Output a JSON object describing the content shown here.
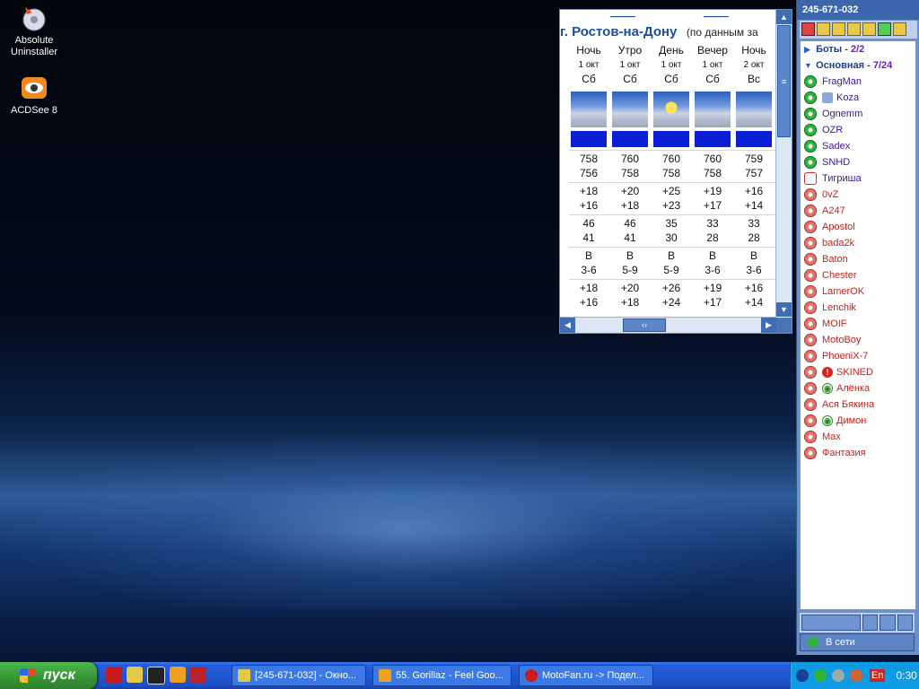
{
  "desktop": {
    "icons": [
      {
        "label_line1": "Absolute",
        "label_line2": "Uninstaller",
        "icon": "uninstaller-icon"
      },
      {
        "label_line1": "ACDSee 8",
        "label_line2": "",
        "icon": "acdsee-icon"
      }
    ]
  },
  "weather": {
    "city": "г. Ростов-на-Дону",
    "source": "(по данным за",
    "columns": [
      {
        "period": "Ночь",
        "date": "1 окт",
        "dow": "Сб",
        "icon": "cloudy",
        "pressure": [
          "758",
          "756"
        ],
        "temp": [
          "+18",
          "+16"
        ],
        "humidity": [
          "46",
          "41"
        ],
        "wind_dir": "В",
        "wind_speed": "3-6",
        "feels": [
          "+18",
          "+16"
        ]
      },
      {
        "period": "Утро",
        "date": "1 окт",
        "dow": "Сб",
        "icon": "cloudy",
        "pressure": [
          "760",
          "758"
        ],
        "temp": [
          "+20",
          "+18"
        ],
        "humidity": [
          "46",
          "41"
        ],
        "wind_dir": "В",
        "wind_speed": "5-9",
        "feels": [
          "+20",
          "+18"
        ]
      },
      {
        "period": "День",
        "date": "1 окт",
        "dow": "Сб",
        "icon": "partly-sunny",
        "pressure": [
          "760",
          "758"
        ],
        "temp": [
          "+25",
          "+23"
        ],
        "humidity": [
          "35",
          "30"
        ],
        "wind_dir": "В",
        "wind_speed": "5-9",
        "feels": [
          "+26",
          "+24"
        ]
      },
      {
        "period": "Вечер",
        "date": "1 окт",
        "dow": "Сб",
        "icon": "cloudy",
        "pressure": [
          "760",
          "758"
        ],
        "temp": [
          "+19",
          "+17"
        ],
        "humidity": [
          "33",
          "28"
        ],
        "wind_dir": "В",
        "wind_speed": "3-6",
        "feels": [
          "+19",
          "+17"
        ]
      },
      {
        "period": "Ночь",
        "date": "2 окт",
        "dow": "Вс",
        "icon": "cloudy",
        "pressure": [
          "759",
          "757"
        ],
        "temp": [
          "+16",
          "+14"
        ],
        "humidity": [
          "33",
          "28"
        ],
        "wind_dir": "В",
        "wind_speed": "3-6",
        "feels": [
          "+16",
          "+14"
        ]
      }
    ]
  },
  "icq": {
    "uin": "245-671-032",
    "groups": [
      {
        "name": "Боты",
        "count": "2/2",
        "expanded": false
      },
      {
        "name": "Основная",
        "count": "7/24",
        "expanded": true
      }
    ],
    "contacts": [
      {
        "name": "FragMan",
        "status": "online",
        "badge": ""
      },
      {
        "name": "Koza",
        "status": "online",
        "badge": "pen"
      },
      {
        "name": "Ognemm",
        "status": "online",
        "badge": ""
      },
      {
        "name": "OZR",
        "status": "online",
        "badge": ""
      },
      {
        "name": "Sadex",
        "status": "online",
        "badge": ""
      },
      {
        "name": "SNHD",
        "status": "online",
        "badge": ""
      },
      {
        "name": "Тигриша",
        "status": "na",
        "badge": ""
      },
      {
        "name": "0vZ",
        "status": "offline",
        "badge": ""
      },
      {
        "name": "A247",
        "status": "offline",
        "badge": ""
      },
      {
        "name": "Apostol",
        "status": "offline",
        "badge": ""
      },
      {
        "name": "bada2k",
        "status": "offline",
        "badge": ""
      },
      {
        "name": "Baton",
        "status": "offline",
        "badge": ""
      },
      {
        "name": "Chester",
        "status": "offline",
        "badge": ""
      },
      {
        "name": "LamerOK",
        "status": "offline",
        "badge": ""
      },
      {
        "name": "Lenchik",
        "status": "offline",
        "badge": ""
      },
      {
        "name": "MOIF",
        "status": "offline",
        "badge": ""
      },
      {
        "name": "MotoBoy",
        "status": "offline",
        "badge": ""
      },
      {
        "name": "PhoeniX-7",
        "status": "offline",
        "badge": ""
      },
      {
        "name": "SKINED",
        "status": "offline",
        "badge": "warn"
      },
      {
        "name": "Алёнка",
        "status": "offline",
        "badge": "eye"
      },
      {
        "name": "Ася Бякина",
        "status": "offline",
        "badge": ""
      },
      {
        "name": "Димон",
        "status": "offline",
        "badge": "eye"
      },
      {
        "name": "Max",
        "status": "offline",
        "badge": ""
      },
      {
        "name": "Фантазия",
        "status": "offline",
        "badge": ""
      }
    ],
    "status_label": "В сети"
  },
  "taskbar": {
    "start_label": "пуск",
    "tasks": [
      {
        "label": "[245-671-032] - Окно...",
        "icon": "icq-icon"
      },
      {
        "label": "55. Gorillaz - Feel Goo...",
        "icon": "winamp-icon"
      },
      {
        "label": "MotoFan.ru -> Подел...",
        "icon": "opera-icon"
      }
    ],
    "tray": {
      "lang": "En",
      "clock": "0:30"
    }
  }
}
